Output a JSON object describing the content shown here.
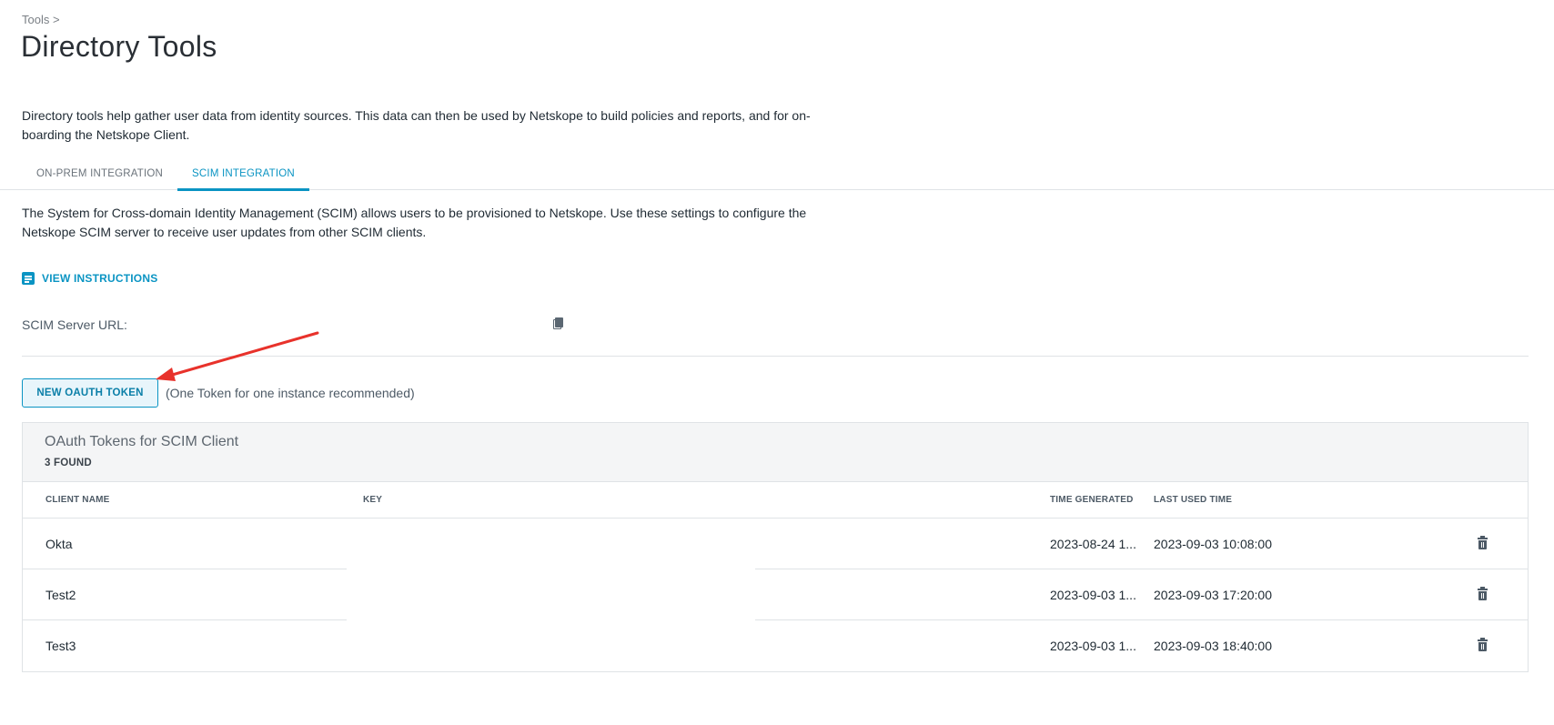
{
  "breadcrumb": "Tools >",
  "page_title": "Directory Tools",
  "intro": "Directory tools help gather user data from identity sources. This data can then be used by Netskope to build policies and reports, and for on-boarding the Netskope Client.",
  "tabs": [
    {
      "label": "ON-PREM INTEGRATION",
      "active": false
    },
    {
      "label": "SCIM INTEGRATION",
      "active": true
    }
  ],
  "scim_description": "The System for Cross-domain Identity Management (SCIM) allows users to be provisioned to Netskope. Use these settings to configure the Netskope SCIM server to receive user updates from other SCIM clients.",
  "view_instructions": "VIEW INSTRUCTIONS",
  "scim_server_url_label": "SCIM Server URL:",
  "new_token_button": "NEW OAUTH TOKEN",
  "token_note": "(One Token for one instance recommended)",
  "tokens_table": {
    "title": "OAuth Tokens for SCIM Client",
    "count": "3 FOUND",
    "columns": [
      "CLIENT NAME",
      "KEY",
      "TIME GENERATED",
      "LAST USED TIME"
    ],
    "rows": [
      {
        "client_name": "Okta",
        "key": "",
        "time_generated": "2023-08-24 1...",
        "last_used": "2023-09-03 10:08:00"
      },
      {
        "client_name": "Test2",
        "key": "",
        "time_generated": "2023-09-03 1...",
        "last_used": "2023-09-03 17:20:00"
      },
      {
        "client_name": "Test3",
        "key": "",
        "time_generated": "2023-09-03 1...",
        "last_used": "2023-09-03 18:40:00"
      }
    ]
  },
  "colors": {
    "accent": "#0a94c3",
    "annotation_arrow": "#e8322b"
  }
}
